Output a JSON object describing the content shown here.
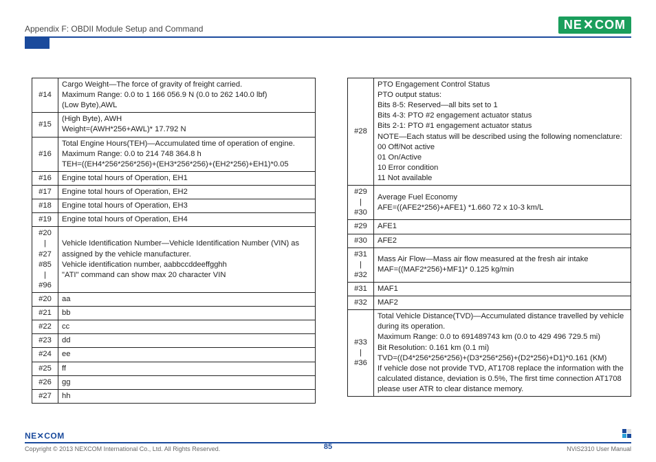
{
  "header": {
    "title": "Appendix F: OBDII Module Setup and Command",
    "logo_text": "NEXCOM"
  },
  "t1": {
    "r0": {
      "idx": "#14",
      "txt": "Cargo Weight—The force of gravity of freight carried.\nMaximum Range: 0.0 to 1 166 056.9 N (0.0 to 262 140.0 lbf)\n(Low Byte),AWL"
    },
    "r1": {
      "idx": "#15",
      "txt": "(High Byte), AWH\nWeight=(AWH*256+AWL)* 17.792 N"
    },
    "r2": {
      "idx": "#16",
      "txt": "Total Engine Hours(TEH)—Accumulated time of operation of engine.\nMaximum Range: 0.0 to 214 748 364.8 h\nTEH=((EH4*256*256*256)+(EH3*256*256)+(EH2*256)+EH1)*0.05"
    },
    "r3": {
      "idx": "#16",
      "txt": "Engine total hours of Operation, EH1"
    },
    "r4": {
      "idx": "#17",
      "txt": "Engine total hours of Operation, EH2"
    },
    "r5": {
      "idx": "#18",
      "txt": "Engine total hours of Operation, EH3"
    },
    "r6": {
      "idx": "#19",
      "txt": "Engine total hours of Operation, EH4"
    },
    "r7": {
      "idx": "#20\n|\n#27\n#85\n|\n#96",
      "txt": "Vehicle Identification Number—Vehicle Identification Number (VIN) as assigned by the vehicle manufacturer.\nVehicle identification number, aabbccddeeffgghh\n\"ATI\" command can show max 20 character VIN"
    },
    "r8": {
      "idx": "#20",
      "txt": "aa"
    },
    "r9": {
      "idx": "#21",
      "txt": "bb"
    },
    "r10": {
      "idx": "#22",
      "txt": "cc"
    },
    "r11": {
      "idx": "#23",
      "txt": "dd"
    },
    "r12": {
      "idx": "#24",
      "txt": "ee"
    },
    "r13": {
      "idx": "#25",
      "txt": "ff"
    },
    "r14": {
      "idx": "#26",
      "txt": "gg"
    },
    "r15": {
      "idx": "#27",
      "txt": "hh"
    }
  },
  "t2": {
    "r0": {
      "idx": "#28",
      "txt": "PTO Engagement Control Status\nPTO output status:\nBits 8-5: Reserved—all bits set to 1\nBits 4-3: PTO #2 engagement actuator status\nBits 2-1: PTO #1 engagement actuator status\nNOTE—Each status will be described using the following nomenclature:\n00 Off/Not active\n01 On/Active\n10 Error condition\n11 Not available"
    },
    "r1": {
      "idx": "#29\n|\n#30",
      "txt": "Average Fuel Economy\nAFE=((AFE2*256)+AFE1) *1.660 72 x 10-3 km/L"
    },
    "r2": {
      "idx": "#29",
      "txt": "AFE1"
    },
    "r3": {
      "idx": "#30",
      "txt": "AFE2"
    },
    "r4": {
      "idx": "#31\n|\n#32",
      "txt": "Mass Air Flow—Mass air flow measured at the fresh air intake\nMAF=((MAF2*256)+MF1)* 0.125 kg/min"
    },
    "r5": {
      "idx": "#31",
      "txt": "MAF1"
    },
    "r6": {
      "idx": "#32",
      "txt": "MAF2"
    },
    "r7": {
      "idx": "#33\n|\n#36",
      "txt": "Total Vehicle Distance(TVD)—Accumulated distance travelled by vehicle during its operation.\nMaximum Range: 0.0 to 691489743 km (0.0 to 429 496 729.5 mi)\nBit Resolution: 0.161 km (0.1 mi)\nTVD=((D4*256*256*256)+(D3*256*256)+(D2*256)+D1)*0.161 (KM)\nIf vehicle dose not provide TVD, AT1708 replace the information with the calculated distance, deviation is 0.5%, The first time connection AT1708 please user ATR to clear distance memory."
    }
  },
  "footer": {
    "logo": "NEXCOM",
    "copyright": "Copyright © 2013 NEXCOM International Co., Ltd. All Rights Reserved.",
    "page": "85",
    "doc": "NViS2310 User Manual"
  }
}
